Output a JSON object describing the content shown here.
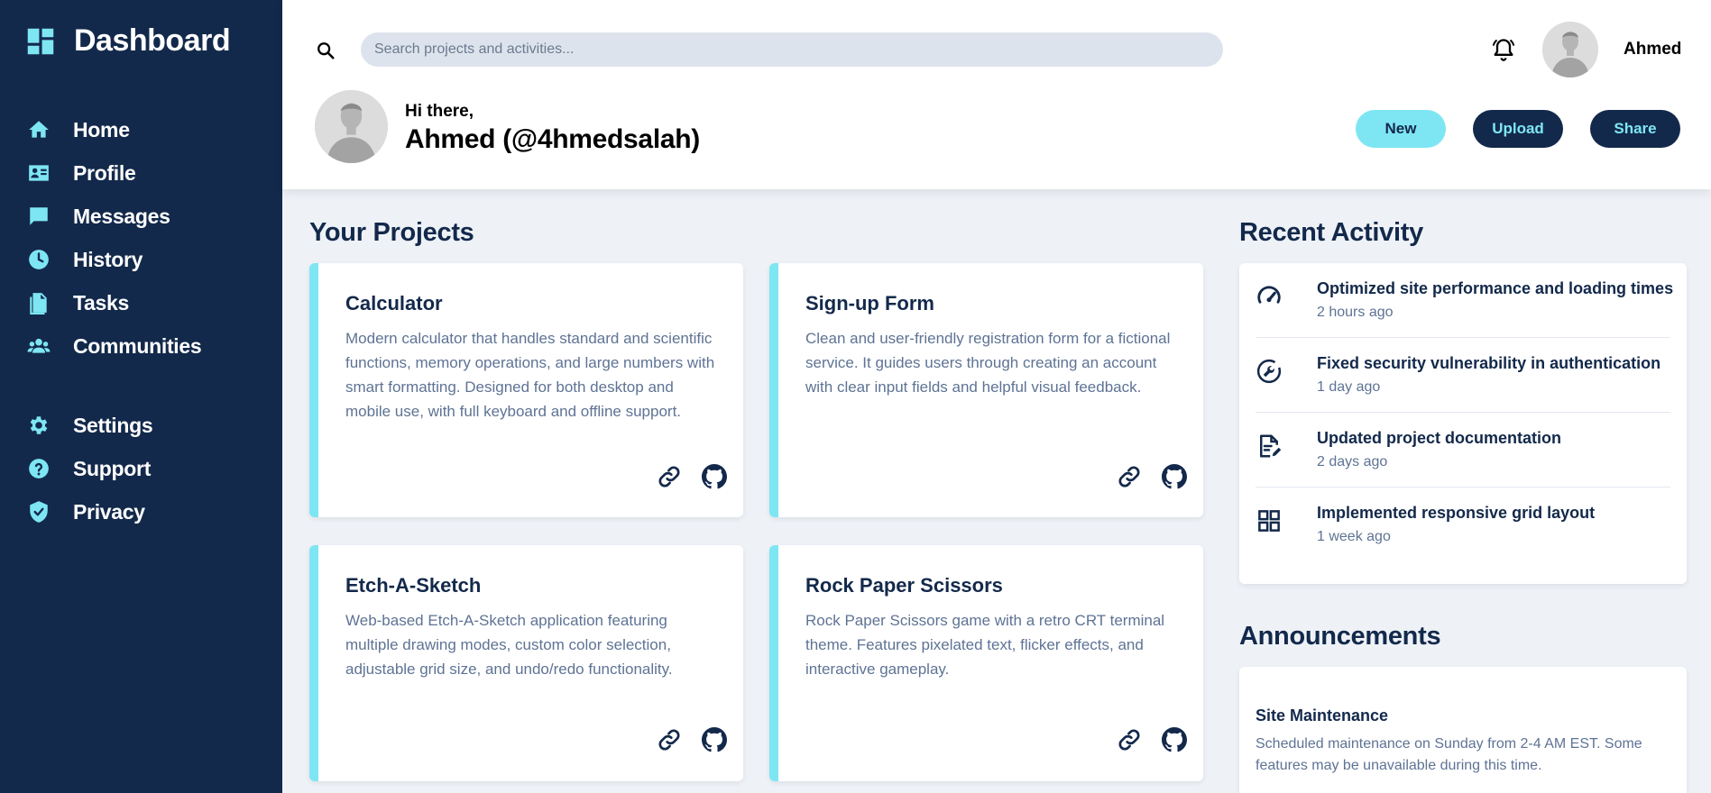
{
  "sidebar": {
    "brand": "Dashboard",
    "nav_primary": [
      {
        "label": "Home",
        "icon": "home-icon"
      },
      {
        "label": "Profile",
        "icon": "id-card-icon"
      },
      {
        "label": "Messages",
        "icon": "message-icon"
      },
      {
        "label": "History",
        "icon": "clock-icon"
      },
      {
        "label": "Tasks",
        "icon": "document-icon"
      },
      {
        "label": "Communities",
        "icon": "users-icon"
      }
    ],
    "nav_secondary": [
      {
        "label": "Settings",
        "icon": "gear-icon"
      },
      {
        "label": "Support",
        "icon": "help-icon"
      },
      {
        "label": "Privacy",
        "icon": "shield-icon"
      }
    ]
  },
  "header": {
    "search_placeholder": "Search projects and activities...",
    "user_name": "Ahmed",
    "greeting": "Hi there,",
    "full_name": "Ahmed (@4hmedsalah)",
    "buttons": {
      "new": "New",
      "upload": "Upload",
      "share": "Share"
    }
  },
  "projects": {
    "title": "Your Projects",
    "items": [
      {
        "title": "Calculator",
        "description": "Modern calculator that handles standard and scientific functions, memory operations, and large numbers with smart formatting. Designed for both desktop and mobile use, with full keyboard and offline support."
      },
      {
        "title": "Sign-up Form",
        "description": "Clean and user-friendly registration form for a fictional service. It guides users through creating an account with clear input fields and helpful visual feedback."
      },
      {
        "title": "Etch-A-Sketch",
        "description": "Web-based Etch-A-Sketch application featuring multiple drawing modes, custom color selection, adjustable grid size, and undo/redo functionality."
      },
      {
        "title": "Rock Paper Scissors",
        "description": "Rock Paper Scissors game with a retro CRT terminal theme. Features pixelated text, flicker effects, and interactive gameplay."
      }
    ]
  },
  "activity": {
    "title": "Recent Activity",
    "items": [
      {
        "title": "Optimized site performance and loading times",
        "time": "2 hours ago",
        "icon": "speedometer-icon"
      },
      {
        "title": "Fixed security vulnerability in authentication",
        "time": "1 day ago",
        "icon": "wrench-icon"
      },
      {
        "title": "Updated project documentation",
        "time": "2 days ago",
        "icon": "document-edit-icon"
      },
      {
        "title": "Implemented responsive grid layout",
        "time": "1 week ago",
        "icon": "grid-icon"
      }
    ]
  },
  "announcements": {
    "title": "Announcements",
    "items": [
      {
        "title": "Site Maintenance",
        "text": "Scheduled maintenance on Sunday from 2-4 AM EST. Some features may be unavailable during this time."
      }
    ]
  },
  "colors": {
    "sidebar_bg": "#13294b",
    "accent": "#7ee6f3",
    "page_bg": "#eef2f7",
    "muted_text": "#5e7394"
  }
}
